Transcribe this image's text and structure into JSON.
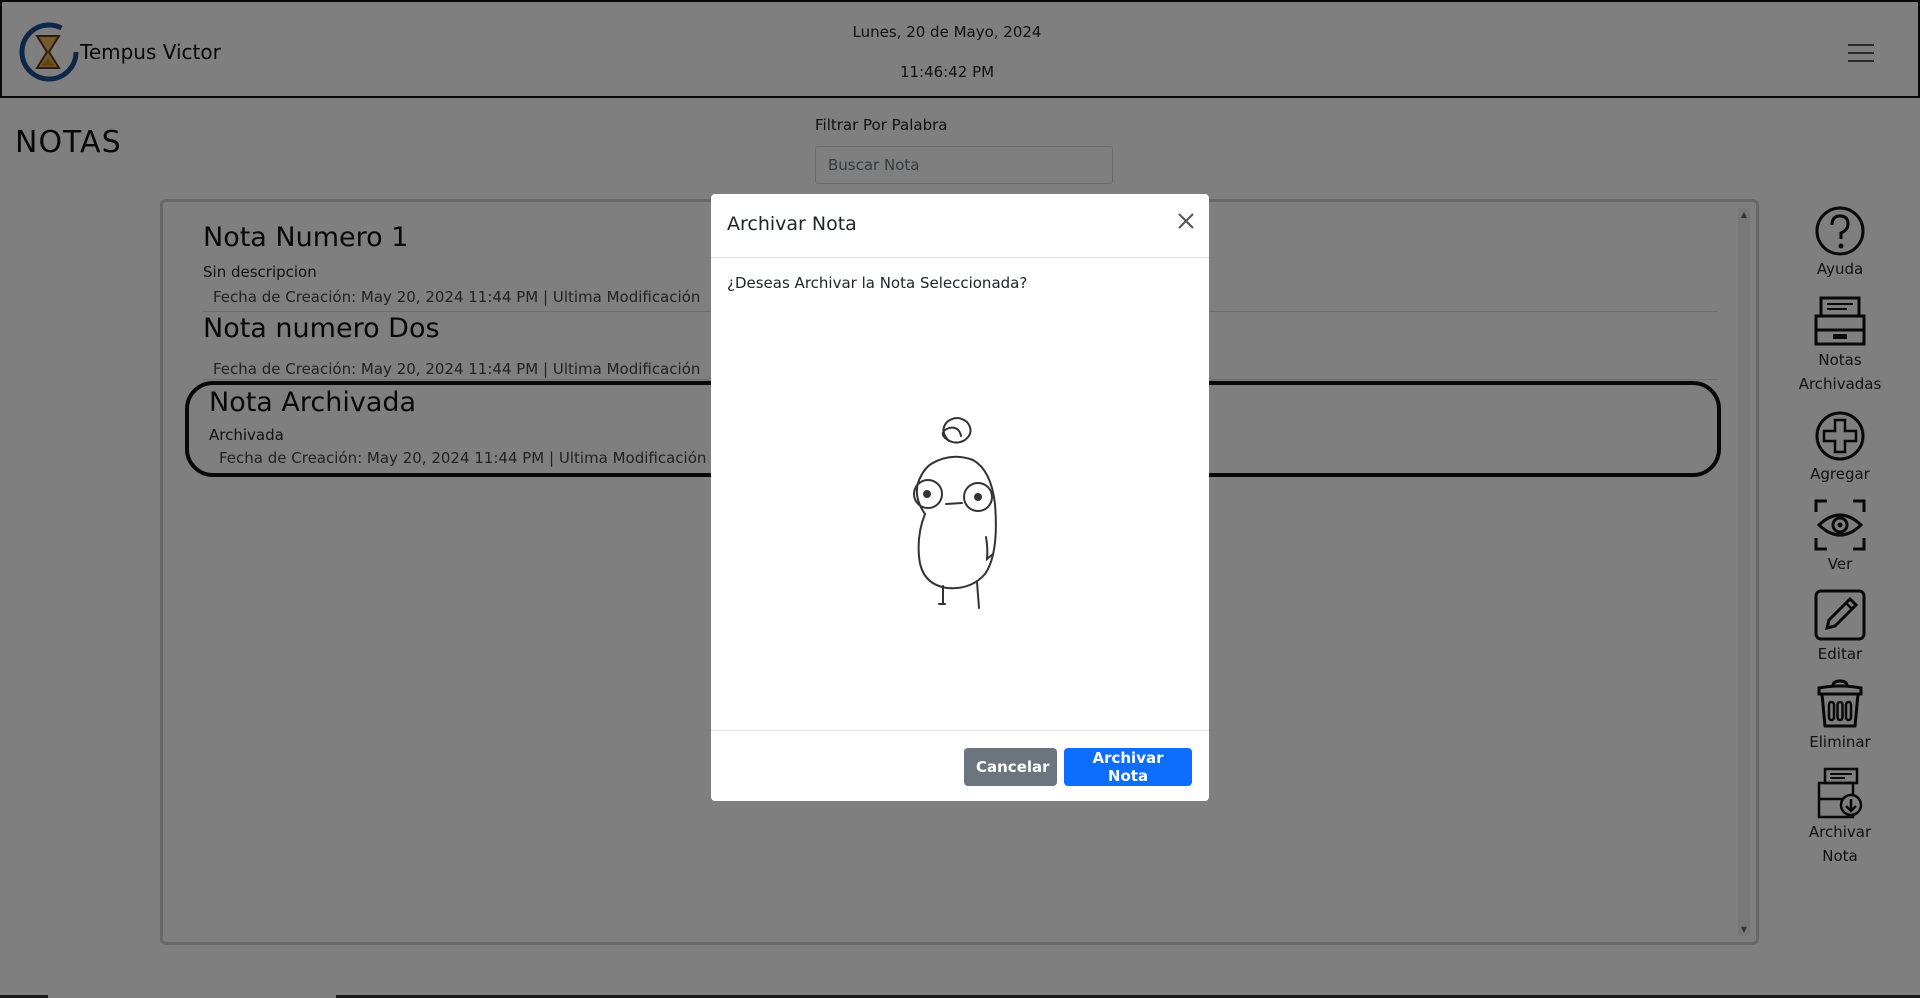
{
  "header": {
    "app_title": "Tempus Victor",
    "date": "Lunes, 20 de Mayo, 2024",
    "time": "11:46:42 PM"
  },
  "page": {
    "title": "NOTAS",
    "filter_label": "Filtrar Por Palabra",
    "search_placeholder": "Buscar Nota"
  },
  "notes": [
    {
      "title": "Nota Numero 1",
      "description": "Sin descripcion",
      "meta": "Fecha de Creación: May 20, 2024 11:44 PM  |  Ultima Modificación"
    },
    {
      "title": "Nota numero Dos",
      "description": "",
      "meta": "Fecha de Creación: May 20, 2024 11:44 PM  |  Ultima Modificación"
    },
    {
      "title": "Nota Archivada",
      "description": "Archivada",
      "meta": "Fecha de Creación: May 20, 2024 11:44 PM  |  Ultima Modificación",
      "selected": true
    }
  ],
  "toolbar": {
    "help": "Ayuda",
    "archived_line1": "Notas",
    "archived_line2": "Archivadas",
    "add": "Agregar",
    "view": "Ver",
    "edit": "Editar",
    "delete": "Eliminar",
    "archive_line1": "Archivar",
    "archive_line2": "Nota"
  },
  "modal": {
    "title": "Archivar Nota",
    "message": "¿Deseas Archivar la Nota Seleccionada?",
    "cancel_label": "Cancelar",
    "confirm_label": "Archivar Nota"
  },
  "colors": {
    "primary": "#0d6efd",
    "secondary": "#6c757d",
    "overlay": "rgba(0,0,0,0.5)"
  },
  "icons": {
    "logo": "hourglass-c-logo",
    "menu": "hamburger-icon",
    "help": "question-circle-icon",
    "archived": "file-cabinet-icon",
    "add": "plus-circle-icon",
    "view": "eye-scan-icon",
    "edit": "pencil-square-icon",
    "delete": "trash-icon",
    "archive": "archive-document-icon",
    "close": "close-icon"
  }
}
